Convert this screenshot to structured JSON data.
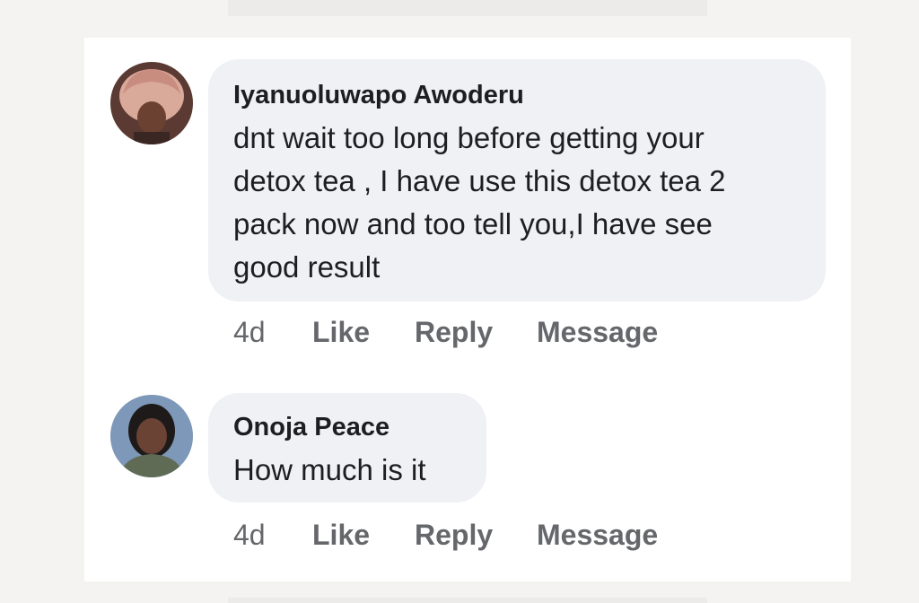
{
  "comments": [
    {
      "author": "Iyanuoluwapo Awoderu",
      "text_lines": [
        "dnt wait too long before getting your",
        "detox tea , I have use this detox tea 2",
        "pack now and too tell you,I have see",
        "good result"
      ],
      "time": "4d",
      "like_label": "Like",
      "reply_label": "Reply",
      "message_label": "Message"
    },
    {
      "author": "Onoja Peace",
      "text_lines": [
        "How much is it"
      ],
      "time": "4d",
      "like_label": "Like",
      "reply_label": "Reply",
      "message_label": "Message"
    }
  ],
  "colors": {
    "bubble": "#f0f1f4",
    "action_text": "#65676b",
    "author_text": "#1c1e21"
  }
}
